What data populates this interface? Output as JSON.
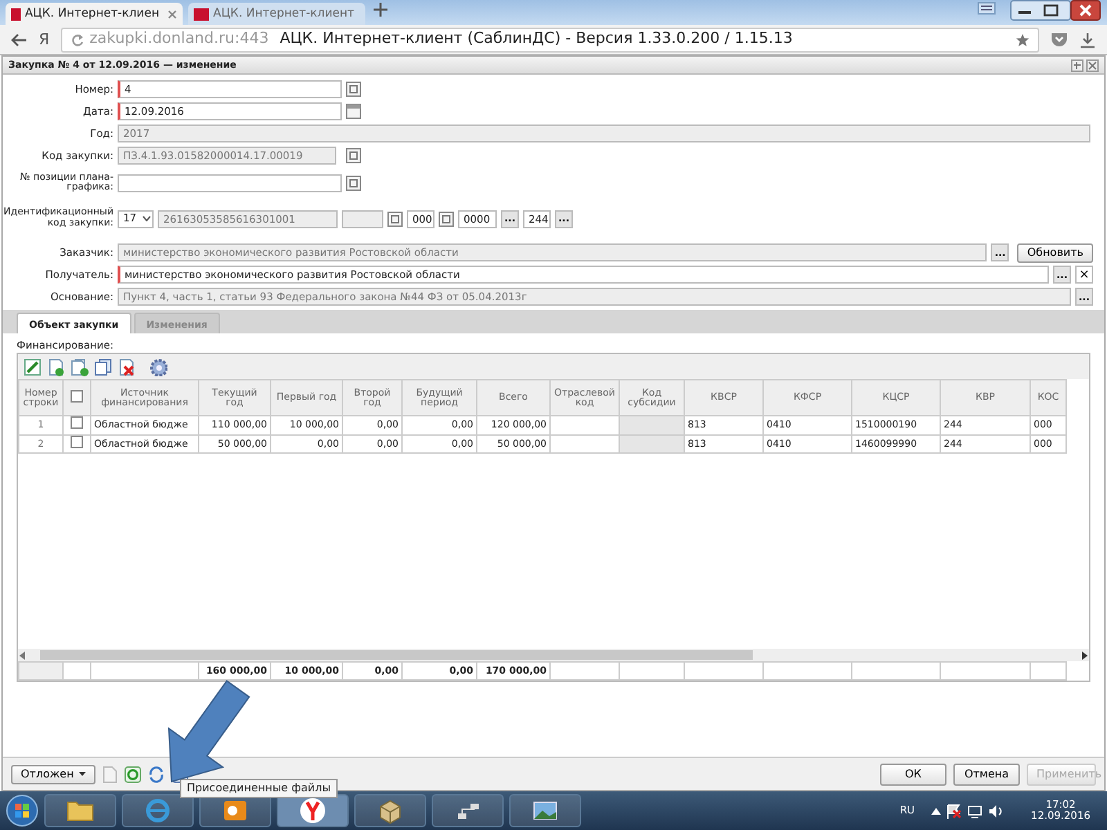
{
  "browser": {
    "tabs": [
      {
        "title": "АЦК. Интернет-клиен",
        "selected": true
      },
      {
        "title": "АЦК. Интернет-клиент",
        "selected": false
      }
    ],
    "home_label": "Я",
    "url_host": "zakupki.donland.ru:443",
    "page_title": "АЦК. Интернет-клиент (СаблинДС) - Версия 1.33.0.200 / 1.15.13"
  },
  "window": {
    "title": "Закупка № 4 от 12.09.2016 — изменение"
  },
  "form": {
    "fields": [
      {
        "label": "Номер:",
        "kind": "lookup",
        "value": "4",
        "required": true,
        "readonly": false
      },
      {
        "label": "Дата:",
        "kind": "date",
        "value": "12.09.2016",
        "required": true,
        "readonly": false
      },
      {
        "label": "Год:",
        "kind": "wide",
        "value": "2017",
        "required": false,
        "readonly": true
      },
      {
        "label": "Код закупки:",
        "kind": "lookup",
        "value": "ПЗ.4.1.93.01582000014.17.00019",
        "required": false,
        "readonly": true
      },
      {
        "label": "№ позиции плана-графика:",
        "kind": "lookup",
        "required": false,
        "readonly": false
      }
    ],
    "ident": {
      "label": "Идентификационный код закупки:",
      "parts": [
        {
          "kind": "select",
          "value": "17"
        },
        {
          "kind": "text",
          "value": "26163053585616301001"
        },
        {
          "kind": "blank"
        },
        {
          "kind": "lookup"
        },
        {
          "kind": "text",
          "value": "000"
        },
        {
          "kind": "lookup"
        },
        {
          "kind": "text",
          "value": "0000"
        },
        {
          "kind": "dots",
          "label": "..."
        },
        {
          "kind": "text",
          "value": "244"
        },
        {
          "kind": "dots",
          "label": "..."
        }
      ]
    },
    "refs": [
      {
        "label": "Заказчик:",
        "value": "министерство экономического развития Ростовской области",
        "required": false,
        "readonly": true,
        "buttons": [
          {
            "kind": "dots",
            "label": "..."
          },
          {
            "kind": "text",
            "label": "Обновить"
          }
        ]
      },
      {
        "label": "Получатель:",
        "value": "министерство экономического развития Ростовской области",
        "required": true,
        "readonly": false,
        "buttons": [
          {
            "kind": "dots",
            "label": "..."
          },
          {
            "kind": "clear",
            "label": "×"
          }
        ]
      },
      {
        "label": "Основание:",
        "value": "Пункт 4, часть 1, статьи 93 Федерального закона №44 ФЗ от 05.04.2013г",
        "required": false,
        "readonly": true,
        "buttons": [
          {
            "kind": "dots",
            "label": "..."
          }
        ]
      }
    ]
  },
  "tabs": [
    {
      "label": "Объект закупки",
      "selected": true
    },
    {
      "label": "Изменения",
      "selected": false
    }
  ],
  "financing": {
    "label": "Финансирование:",
    "columns": [
      {
        "kind": "text",
        "label": "Номер строки"
      },
      {
        "kind": "check",
        "checked": false
      },
      {
        "kind": "text",
        "label": "Источник финансирования"
      },
      {
        "kind": "text",
        "label": "Текущий год"
      },
      {
        "kind": "text",
        "label": "Первый год"
      },
      {
        "kind": "text",
        "label": "Второй год"
      },
      {
        "kind": "text",
        "label": "Будущий период"
      },
      {
        "kind": "text",
        "label": "Всего"
      },
      {
        "kind": "text",
        "label": "Отраслевой код"
      },
      {
        "kind": "text",
        "label": "Код субсидии"
      },
      {
        "kind": "text",
        "label": "КВСР"
      },
      {
        "kind": "text",
        "label": "КФСР"
      },
      {
        "kind": "text",
        "label": "КЦСР"
      },
      {
        "kind": "text",
        "label": "КВР"
      },
      {
        "kind": "text",
        "label": "КОС"
      }
    ],
    "rows": [
      {
        "checked": false,
        "cells": [
          "1",
          "",
          "Областной бюдже",
          "110 000,00",
          "10 000,00",
          "0,00",
          "0,00",
          "120 000,00",
          "",
          "",
          "813",
          "0410",
          "1510000190",
          "244",
          "000"
        ]
      },
      {
        "checked": false,
        "cells": [
          "2",
          "",
          "Областной бюдже",
          "50 000,00",
          "0,00",
          "0,00",
          "0,00",
          "50 000,00",
          "",
          "",
          "813",
          "0410",
          "1460099990",
          "244",
          "000"
        ]
      }
    ],
    "totals": [
      "160 000,00",
      "10 000,00",
      "0,00",
      "0,00",
      "170 000,00"
    ]
  },
  "footer": {
    "status": "Отложен",
    "tooltip": "Присоединенные файлы",
    "buttons": [
      {
        "label": "ОК",
        "disabled": false
      },
      {
        "label": "Отмена",
        "disabled": false
      },
      {
        "label": "Применить",
        "disabled": true
      }
    ]
  },
  "taskbar": {
    "language": "RU",
    "time": "17:02",
    "date": "12.09.2016"
  }
}
